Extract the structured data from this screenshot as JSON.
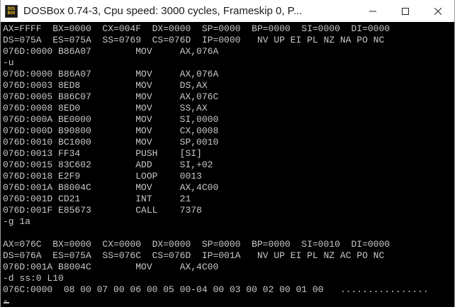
{
  "window": {
    "title": "DOSBox 0.74-3, Cpu speed:     3000 cycles, Frameskip  0, P...",
    "icon_text_top": "DOS",
    "icon_text_bottom": "BOX"
  },
  "controls": {
    "minimize_icon": "minimize-icon",
    "maximize_icon": "maximize-icon",
    "close_icon": "close-icon"
  },
  "console": {
    "lines": [
      "AX=FFFF  BX=0000  CX=004F  DX=0000  SP=0000  BP=0000  SI=0000  DI=0000",
      "DS=075A  ES=075A  SS=0769  CS=076D  IP=0000   NV UP EI PL NZ NA PO NC",
      "076D:0000 B86A07        MOV     AX,076A",
      "-u",
      "076D:0000 B86A07        MOV     AX,076A",
      "076D:0003 8ED8          MOV     DS,AX",
      "076D:0005 B86C07        MOV     AX,076C",
      "076D:0008 8ED0          MOV     SS,AX",
      "076D:000A BE0000        MOV     SI,0000",
      "076D:000D B90800        MOV     CX,0008",
      "076D:0010 BC1000        MOV     SP,0010",
      "076D:0013 FF34          PUSH    [SI]",
      "076D:0015 83C602        ADD     SI,+02",
      "076D:0018 E2F9          LOOP    0013",
      "076D:001A B8004C        MOV     AX,4C00",
      "076D:001D CD21          INT     21",
      "076D:001F E85673        CALL    7378",
      "-g 1a",
      "",
      "AX=076C  BX=0000  CX=0000  DX=0000  SP=0000  BP=0000  SI=0010  DI=0000",
      "DS=076A  ES=075A  SS=076C  CS=076D  IP=001A   NV UP EI PL NZ AC PO NC",
      "076D:001A B8004C        MOV     AX,4C00",
      "-d ss:0 L10",
      "076C:0000  08 00 07 00 06 00 05 00-04 00 03 00 02 00 01 00   ................",
      "-"
    ]
  }
}
